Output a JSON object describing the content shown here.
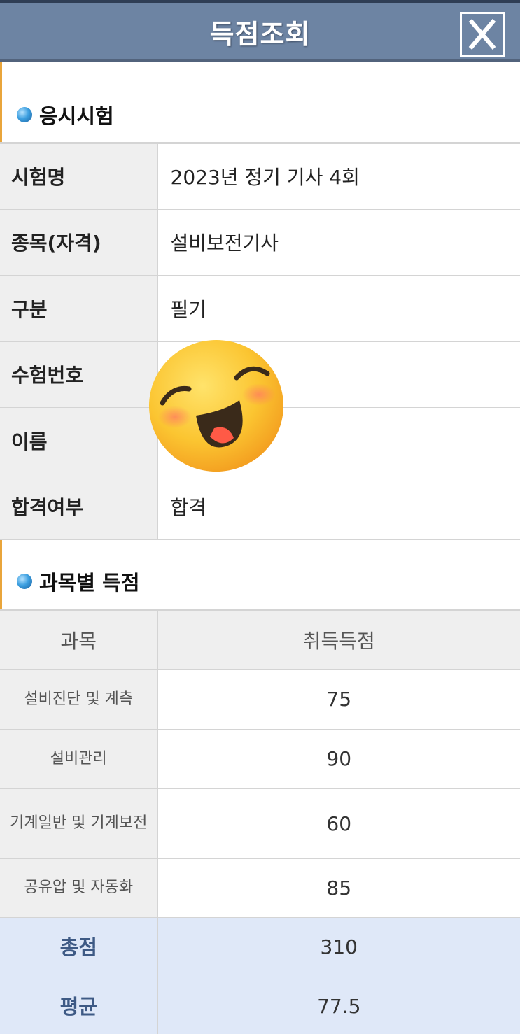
{
  "header": {
    "title": "득점조회",
    "close_icon": "close-icon"
  },
  "sections": {
    "exam": "응시시험",
    "scores": "과목별 득점"
  },
  "exam_info": [
    {
      "label": "시험명",
      "value": "2023년 정기 기사 4회"
    },
    {
      "label": "종목(자격)",
      "value": "설비보전기사"
    },
    {
      "label": "구분",
      "value": "필기"
    },
    {
      "label": "수험번호",
      "value": ""
    },
    {
      "label": "이름",
      "value": ""
    },
    {
      "label": "합격여부",
      "value": "합격"
    }
  ],
  "score_table": {
    "headers": [
      "과목",
      "취득득점"
    ],
    "rows": [
      {
        "subject": "설비진단 및 계측",
        "score": "75"
      },
      {
        "subject": "설비관리",
        "score": "90"
      },
      {
        "subject": "기계일반 및 기계보전",
        "score": "60"
      },
      {
        "subject": "공유압 및 자동화",
        "score": "85"
      }
    ],
    "total_label": "총점",
    "total": "310",
    "average_label": "평균",
    "average": "77.5"
  },
  "overlay": {
    "emoji": "smiling-face-emoji"
  },
  "colors": {
    "header": "#6d84a3",
    "summary_row": "#dfe8f8",
    "summary_label": "#3e5a85",
    "accent_bar": "#e9a53b"
  }
}
